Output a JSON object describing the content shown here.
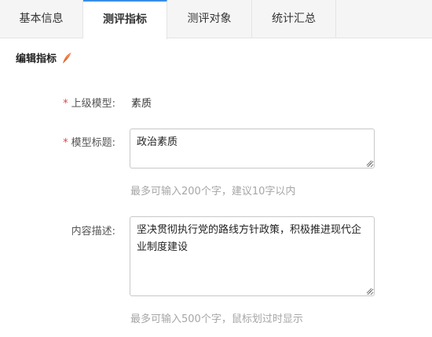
{
  "tabs": [
    {
      "label": "基本信息",
      "active": false
    },
    {
      "label": "测评指标",
      "active": true
    },
    {
      "label": "测评对象",
      "active": false
    },
    {
      "label": "统计汇总",
      "active": false
    }
  ],
  "section": {
    "title": "编辑指标",
    "icon": "pen-icon"
  },
  "form": {
    "parent_model": {
      "required_mark": "*",
      "label": "上级模型:",
      "value": "素质"
    },
    "model_title": {
      "required_mark": "*",
      "label": "模型标题:",
      "value": "政治素质",
      "hint": "最多可输入200个字，建议10字以内"
    },
    "content_desc": {
      "label": "内容描述:",
      "value": "坚决贯彻执行党的路线方针政策，积极推进现代企业制度建设",
      "hint": "最多可输入500个字，鼠标划过时显示"
    }
  },
  "colors": {
    "accent": "#3a8ee6",
    "required": "#e04343",
    "pen_icon": "#f07a3a",
    "hint": "#a6a6a6"
  }
}
